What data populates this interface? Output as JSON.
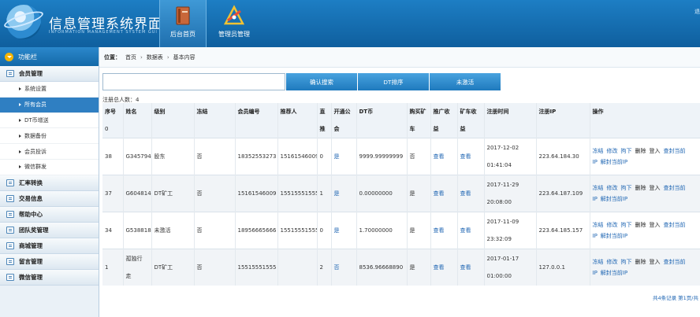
{
  "header": {
    "title": "信息管理系统界面",
    "subtitle": "INFORMATION MANAGEMENT SYSTEM GUI",
    "nav": [
      {
        "label": "后台首页",
        "active": true
      },
      {
        "label": "管理员管理",
        "active": false
      }
    ],
    "right_text": "退"
  },
  "sidebar": {
    "title": "功能栏",
    "groups": [
      {
        "label": "会员管理",
        "items": [
          "系统设置",
          "所有会员",
          "DT币增送",
          "数据备份",
          "会员投诉",
          "微信群发"
        ],
        "active_item": 1
      },
      {
        "label": "汇率转换"
      },
      {
        "label": "交易信息"
      },
      {
        "label": "帮助中心"
      },
      {
        "label": "团队奖管理"
      },
      {
        "label": "商城管理"
      },
      {
        "label": "留言管理"
      },
      {
        "label": "微信管理"
      }
    ]
  },
  "breadcrumb": {
    "prefix": "位置：",
    "items": [
      "首页",
      "数据表",
      "基本内容"
    ]
  },
  "toolbar": {
    "search_value": "",
    "buttons": [
      "确认搜索",
      "DT排序",
      "未激活"
    ]
  },
  "summary": {
    "total": "注册总人数：4"
  },
  "table": {
    "headers_top": [
      "序号",
      "姓名",
      "级别",
      "冻结",
      "会员编号",
      "推荐人",
      "直",
      "开通公",
      "DT币",
      "购买矿",
      "推广收",
      "矿车收",
      "注册时间",
      "注册IP",
      "操作"
    ],
    "headers_bottom": [
      "0",
      "推",
      "会",
      "车",
      "益",
      "益"
    ],
    "rows": [
      {
        "id": "38",
        "name": "G345794",
        "level": "股东",
        "frozen": "否",
        "member_no": "18352553273",
        "referrer": "15161546009",
        "direct": "0",
        "open": "是",
        "dt": "9999.99999999",
        "buy": "否",
        "promo": "查看",
        "cart": "查看",
        "date": "2017-12-02",
        "time": "01:41:04",
        "ip": "223.64.184.30"
      },
      {
        "id": "37",
        "name": "G604814",
        "level": "DT矿工",
        "frozen": "否",
        "member_no": "15161546009",
        "referrer": "15515551555",
        "direct": "1",
        "open": "是",
        "dt": "0.00000000",
        "buy": "是",
        "promo": "查看",
        "cart": "查看",
        "date": "2017-11-29",
        "time": "20:08:00",
        "ip": "223.64.187.109"
      },
      {
        "id": "34",
        "name": "G538818",
        "level": "未激活",
        "frozen": "否",
        "member_no": "18956665666",
        "referrer": "15515551555",
        "direct": "0",
        "open": "是",
        "dt": "1.70000000",
        "buy": "是",
        "promo": "查看",
        "cart": "查看",
        "date": "2017-11-09",
        "time": "23:32:09",
        "ip": "223.64.185.157"
      },
      {
        "id": "1",
        "name": "孤独行\n走",
        "level": "DT矿工",
        "frozen": "否",
        "member_no": "15515551555",
        "referrer": "",
        "direct": "2",
        "open": "否",
        "dt": "8536.96668890",
        "buy": "是",
        "promo": "查看",
        "cart": "查看",
        "date": "2017-01-17",
        "time": "01:00:00",
        "ip": "127.0.0.1"
      }
    ],
    "ops_line1": [
      "冻结",
      "修改",
      "拘下",
      "删除",
      "登入",
      "查封当前"
    ],
    "ops_line2": [
      "IP",
      "解封当前IP"
    ]
  },
  "pager": {
    "text": "共4条记录 第1页/共"
  }
}
